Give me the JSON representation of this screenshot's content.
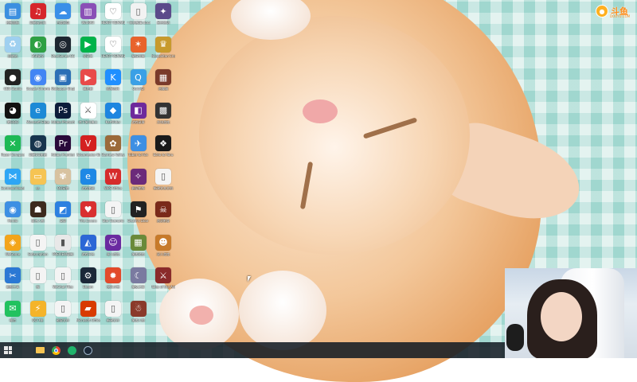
{
  "watermark": {
    "brand": "斗鱼",
    "domain": "DOUYU.COM"
  },
  "desktop_icons": [
    {
      "label": "控制面板",
      "icon": "control-panel-icon",
      "color": "#3b8fe0",
      "glyph": "▤"
    },
    {
      "label": "网易云音乐",
      "icon": "netease-music-icon",
      "color": "#d6262b",
      "glyph": "♫"
    },
    {
      "label": "百度网盘",
      "icon": "baidu-netdisk-icon",
      "color": "#3a8fe8",
      "glyph": "☁"
    },
    {
      "label": "WinRAR",
      "icon": "winrar-icon",
      "color": "#8a4fb6",
      "glyph": "▥"
    },
    {
      "label": "HEART REMAKE",
      "icon": "heart-remake-icon",
      "color": "#ffffff",
      "glyph": "♡"
    },
    {
      "label": "一天的故事.docx",
      "icon": "document-icon",
      "color": "#f2f2f2",
      "glyph": "▯"
    },
    {
      "label": "星空物语",
      "icon": "anime-game-icon",
      "color": "#5b4a8a",
      "glyph": "✦"
    },
    {
      "label": "回收站",
      "icon": "recycle-bin-icon",
      "color": "#9fd0f0",
      "glyph": "♻"
    },
    {
      "label": "360安全",
      "icon": "security-360-icon",
      "color": "#2ea043",
      "glyph": "◐"
    },
    {
      "label": "SteelSeries GG",
      "icon": "steelseries-icon",
      "color": "#1d2630",
      "glyph": "◎"
    },
    {
      "label": "爱奇艺",
      "icon": "iqiyi-icon",
      "color": "#00b34a",
      "glyph": "▶"
    },
    {
      "label": "HEART REMAKE 2",
      "icon": "heart-remake-icon",
      "color": "#ffffff",
      "glyph": "♡"
    },
    {
      "label": "星际争霸",
      "icon": "starcraft-icon",
      "color": "#e8632b",
      "glyph": "✶"
    },
    {
      "label": "Neopolitan Crowns",
      "icon": "crown-game-icon",
      "color": "#c79a2d",
      "glyph": "♛"
    },
    {
      "label": "OBS Studio",
      "icon": "obs-icon",
      "color": "#222222",
      "glyph": "●"
    },
    {
      "label": "Google Chrome",
      "icon": "chrome-icon",
      "color": "#4285f4",
      "glyph": "◉"
    },
    {
      "label": "Wallpaper Engine",
      "icon": "wallpaper-engine-icon",
      "color": "#2b6fb6",
      "glyph": "▣"
    },
    {
      "label": "幕后影",
      "icon": "video-app-icon",
      "color": "#e84a4a",
      "glyph": "▶"
    },
    {
      "label": "酷狗音乐",
      "icon": "kugou-icon",
      "color": "#1f8fff",
      "glyph": "K"
    },
    {
      "label": "QuickQ",
      "icon": "quickq-icon",
      "color": "#3aa0e6",
      "glyph": "Q"
    },
    {
      "label": "恶魔城",
      "icon": "game-icon",
      "color": "#7a3a2a",
      "glyph": "▦"
    },
    {
      "label": "腾讯QQ",
      "icon": "qq-icon",
      "color": "#111111",
      "glyph": "◕"
    },
    {
      "label": "Microsoft Edge",
      "icon": "edge-icon",
      "color": "#1c8ad6",
      "glyph": "e"
    },
    {
      "label": "Adobe Photoshop",
      "icon": "photoshop-icon",
      "color": "#0c1c3a",
      "glyph": "Ps"
    },
    {
      "label": "地下城与勇士",
      "icon": "dnf-icon",
      "color": "#ffffff",
      "glyph": "⚔"
    },
    {
      "label": "KartRider",
      "icon": "kart-icon",
      "color": "#1e86e0",
      "glyph": "◆"
    },
    {
      "label": "游戏录屏",
      "icon": "screen-record-icon",
      "color": "#6e2a9c",
      "glyph": "◧"
    },
    {
      "label": "方块游戏",
      "icon": "qr-game-icon",
      "color": "#333333",
      "glyph": "▩"
    },
    {
      "label": "Razer Synapse",
      "icon": "razer-icon",
      "color": "#1db954",
      "glyph": "✕"
    },
    {
      "label": "网易UU加速",
      "icon": "uu-accelerator-icon",
      "color": "#17344d",
      "glyph": "◍"
    },
    {
      "label": "Adobe Premiere Pro",
      "icon": "premiere-icon",
      "color": "#2a0a3a",
      "glyph": "Pr"
    },
    {
      "label": "Voicemeeter Banana",
      "icon": "voicemeeter-icon",
      "color": "#d42020",
      "glyph": "V"
    },
    {
      "label": "Stardew Valley",
      "icon": "stardew-icon",
      "color": "#9b6a3a",
      "glyph": "✿"
    },
    {
      "label": "Tuber to Fox",
      "icon": "tube-icon",
      "color": "#3d8fe3",
      "glyph": "✈"
    },
    {
      "label": "Echo to Yoru",
      "icon": "echo-icon",
      "color": "#1a1a1a",
      "glyph": "❖"
    },
    {
      "label": "Sunmoon4ever",
      "icon": "mirror-app-icon",
      "color": "#2ea6f5",
      "glyph": "⋈"
    },
    {
      "label": "ss",
      "icon": "folder-icon",
      "color": "#f6c453",
      "glyph": "▭"
    },
    {
      "label": "QQ宠物",
      "icon": "pet-app-icon",
      "color": "#d8c2a0",
      "glyph": "✾"
    },
    {
      "label": "游戏加速",
      "icon": "ie-icon",
      "color": "#1e88e5",
      "glyph": "e"
    },
    {
      "label": "WPS Office",
      "icon": "wps-icon",
      "color": "#d62b2b",
      "glyph": "W"
    },
    {
      "label": "碧蓝航线",
      "icon": "azur-lane-icon",
      "color": "#6b2a7a",
      "glyph": "✧"
    },
    {
      "label": "新建文本文档",
      "icon": "text-file-icon",
      "color": "#f4f4f4",
      "glyph": "▯"
    },
    {
      "label": "Pendo",
      "icon": "camera-icon",
      "color": "#3d8fe3",
      "glyph": "◉"
    },
    {
      "label": "第五人格",
      "icon": "identity-v-icon",
      "color": "#3c2a1e",
      "glyph": "☗"
    },
    {
      "label": "录屏",
      "icon": "record-icon",
      "color": "#2c80e0",
      "glyph": "◩"
    },
    {
      "label": "The Lovers",
      "icon": "lovers-icon",
      "color": "#d93030",
      "glyph": "♥"
    },
    {
      "label": "Star Scenario",
      "icon": "blank-file-icon",
      "color": "#f4f4f4",
      "glyph": "▯"
    },
    {
      "label": "Death's Door",
      "icon": "deaths-door-icon",
      "color": "#222222",
      "glyph": "⚑"
    },
    {
      "label": "恶灵附身",
      "icon": "horror-game-icon",
      "color": "#7a2a1a",
      "glyph": "☠"
    },
    {
      "label": "WeGame",
      "icon": "wegame-icon",
      "color": "#f3a51b",
      "glyph": "◈"
    },
    {
      "label": "Subscription",
      "icon": "subscription-icon",
      "color": "#f4f4f4",
      "glyph": "▯"
    },
    {
      "label": "PREVIEW录制",
      "icon": "preview-icon",
      "color": "#e8e8e8",
      "glyph": "▮"
    },
    {
      "label": "游戏平台",
      "icon": "store-icon",
      "color": "#2c67d6",
      "glyph": "◭"
    },
    {
      "label": "多人游戏",
      "icon": "multiplayer-icon",
      "color": "#6a2aa0",
      "glyph": "☺"
    },
    {
      "label": "像素游戏",
      "icon": "pixel-game-icon",
      "color": "#6a8a3a",
      "glyph": "▦"
    },
    {
      "label": "双人游戏",
      "icon": "duo-game-icon",
      "color": "#c77a2a",
      "glyph": "☻"
    },
    {
      "label": "截图工具",
      "icon": "snipping-icon",
      "color": "#2a78d4",
      "glyph": "✂"
    },
    {
      "label": "猫",
      "icon": "cat-doc-icon",
      "color": "#f4f4f4",
      "glyph": "▯"
    },
    {
      "label": "WeChat Files",
      "icon": "doc-icon",
      "color": "#f4f4f4",
      "glyph": "▯"
    },
    {
      "label": "Steam",
      "icon": "steam-icon",
      "color": "#1b2838",
      "glyph": "⚙"
    },
    {
      "label": "快乐小鸭",
      "icon": "duck-game-icon",
      "color": "#e24a2a",
      "glyph": "✹"
    },
    {
      "label": "魔女之泉",
      "icon": "witch-game-icon",
      "color": "#7a7aa0",
      "glyph": "☾"
    },
    {
      "label": "Tales of the Arkside",
      "icon": "tales-game-icon",
      "color": "#8a2a2a",
      "glyph": "⚔"
    },
    {
      "label": "微信",
      "icon": "wechat-icon",
      "color": "#21c25e",
      "glyph": "✉"
    },
    {
      "label": "QQ飞车",
      "icon": "qq-speed-icon",
      "color": "#f4b42a",
      "glyph": "⚡"
    },
    {
      "label": "截屏文件",
      "icon": "screenshot-doc-icon",
      "color": "#f4f4f4",
      "glyph": "▯"
    },
    {
      "label": "Microsoft Office",
      "icon": "office-icon",
      "color": "#d83b01",
      "glyph": "▰"
    },
    {
      "label": "新建文件",
      "icon": "new-file-icon",
      "color": "#f4f4f4",
      "glyph": "▯"
    },
    {
      "label": "像素人物",
      "icon": "character-game-icon",
      "color": "#8a3a2a",
      "glyph": "☃"
    }
  ],
  "taskbar": {
    "start_glyph": "⊞",
    "items": [
      "start-button",
      "file-explorer",
      "chrome",
      "green-app",
      "steam"
    ]
  }
}
